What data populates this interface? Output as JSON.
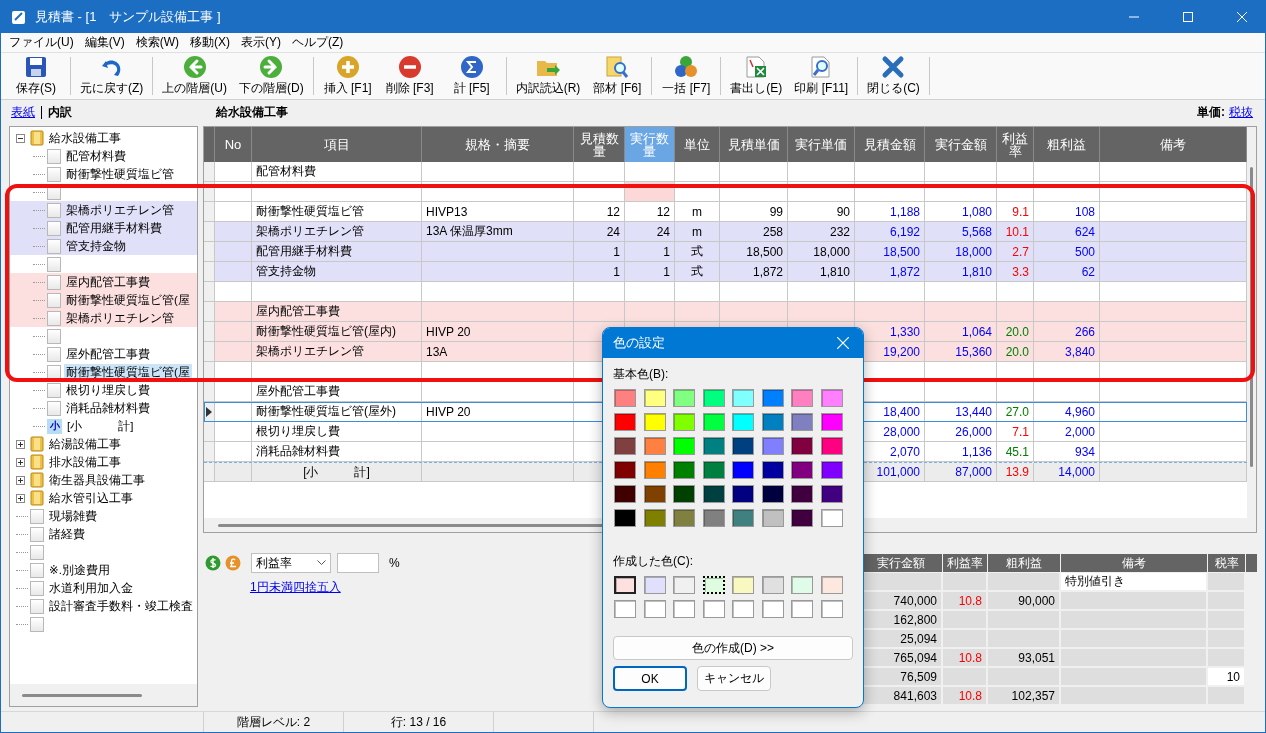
{
  "window": {
    "title": "見積書 - [1　サンプル設備工事 ]"
  },
  "menu": [
    "ファイル(U)",
    "編集(V)",
    "検索(W)",
    "移動(X)",
    "表示(Y)",
    "ヘルプ(Z)"
  ],
  "toolbar": [
    {
      "label": "保存(S)",
      "kind": "save",
      "separator_after": true
    },
    {
      "label": "元に戻す(Z)",
      "kind": "undo",
      "separator_after": true
    },
    {
      "label": "上の階層(U)",
      "kind": "up",
      "separator_after": false
    },
    {
      "label": "下の階層(D)",
      "kind": "down",
      "separator_after": true
    },
    {
      "label": "挿入 [F1]",
      "kind": "insert",
      "separator_after": false
    },
    {
      "label": "削除 [F3]",
      "kind": "delete",
      "separator_after": false
    },
    {
      "label": "計 [F5]",
      "kind": "sum",
      "separator_after": true
    },
    {
      "label": "内訳読込(R)",
      "kind": "import",
      "separator_after": false
    },
    {
      "label": "部材 [F6]",
      "kind": "parts",
      "separator_after": true
    },
    {
      "label": "一括 [F7]",
      "kind": "batch",
      "separator_after": true
    },
    {
      "label": "書出し(E)",
      "kind": "export",
      "separator_after": false
    },
    {
      "label": "印刷 [F11]",
      "kind": "print",
      "separator_after": true
    },
    {
      "label": "閉じる(C)",
      "kind": "close",
      "separator_after": true
    }
  ],
  "breadcrumb": {
    "link": "表紙",
    "current": "内訳"
  },
  "section_title": "給水設備工事",
  "price_mode": {
    "label": "単価:",
    "value": "税抜"
  },
  "tree": [
    {
      "label": "給水設備工事",
      "kind": "folder",
      "expanded": true,
      "selected": false,
      "children": [
        {
          "label": "配管材料費",
          "kind": "doc",
          "selected": false,
          "color": "#ffffff"
        },
        {
          "label": "耐衝撃性硬質塩ビ管",
          "kind": "doc",
          "selected": false,
          "color": "#ffffff"
        },
        {
          "kind": "doc",
          "color": "#ffffff"
        },
        {
          "label": "架橋ポリエチレン管",
          "kind": "doc",
          "selected": false,
          "color": "#e0e0f8"
        },
        {
          "label": "配管用継手材料費",
          "kind": "doc",
          "selected": false,
          "color": "#e0e0f8"
        },
        {
          "label": "管支持金物",
          "kind": "doc",
          "selected": false,
          "color": "#e0e0f8"
        },
        {
          "kind": "doc",
          "color": "#ffffff"
        },
        {
          "label": "屋内配管工事費",
          "kind": "doc",
          "selected": false,
          "color": "#fce0e0"
        },
        {
          "label": "耐衝撃性硬質塩ビ管(屋",
          "kind": "doc",
          "selected": false,
          "color": "#fce0e0"
        },
        {
          "label": "架橋ポリエチレン管",
          "kind": "doc",
          "selected": false,
          "color": "#fce0e0"
        },
        {
          "kind": "doc",
          "color": "#ffffff"
        },
        {
          "label": "屋外配管工事費",
          "kind": "doc",
          "selected": false,
          "color": "#ffffff"
        },
        {
          "label": "耐衝撃性硬質塩ビ管(屋",
          "kind": "doc",
          "selected": true,
          "color": "#ffffff"
        },
        {
          "label": "根切り埋戻し費",
          "kind": "doc",
          "selected": false,
          "color": "#ffffff"
        },
        {
          "label": "消耗品雑材料費",
          "kind": "doc",
          "selected": false,
          "color": "#ffffff"
        },
        {
          "label": "[小　　　計]",
          "kind": "subtotal",
          "badge": "小",
          "selected": false,
          "color": "#ffffff"
        }
      ]
    },
    {
      "label": "給湯設備工事",
      "kind": "folder",
      "expanded": false,
      "selected": false
    },
    {
      "label": "排水設備工事",
      "kind": "folder",
      "expanded": false,
      "selected": false
    },
    {
      "label": "衛生器具設備工事",
      "kind": "folder",
      "expanded": false,
      "selected": false
    },
    {
      "label": "給水管引込工事",
      "kind": "folder",
      "expanded": false,
      "selected": false
    },
    {
      "label": "現場雑費",
      "kind": "doc",
      "selected": false
    },
    {
      "label": "諸経費",
      "kind": "doc",
      "selected": false
    },
    {
      "kind": "doc"
    },
    {
      "label": "※.別途費用",
      "kind": "doc",
      "selected": false
    },
    {
      "label": "水道利用加入金",
      "kind": "doc",
      "selected": false
    },
    {
      "label": "設計審査手数料・竣工検査",
      "kind": "doc",
      "selected": false
    },
    {
      "kind": "doc"
    }
  ],
  "table": {
    "columns": [
      {
        "label": "No",
        "kind": "index",
        "selected": false
      },
      {
        "label": "項目",
        "kind": "text",
        "selected": false
      },
      {
        "label": "規格・摘要",
        "kind": "text",
        "selected": false
      },
      {
        "label": "見積数量",
        "kind": "number",
        "selected": false
      },
      {
        "label": "実行数量",
        "kind": "number",
        "selected": true
      },
      {
        "label": "単位",
        "kind": "unit",
        "selected": false
      },
      {
        "label": "見積単価",
        "kind": "number",
        "selected": false
      },
      {
        "label": "実行単価",
        "kind": "number",
        "selected": false
      },
      {
        "label": "見積金額",
        "kind": "amount",
        "selected": false
      },
      {
        "label": "実行金額",
        "kind": "amount",
        "selected": false
      },
      {
        "label": "利益率",
        "kind": "rate",
        "selected": false
      },
      {
        "label": "粗利益",
        "kind": "amount",
        "selected": false
      },
      {
        "label": "備考",
        "kind": "text",
        "selected": false
      }
    ],
    "rows": [
      {
        "kind": "item",
        "color": "#ffffff",
        "selected": false,
        "flag": false,
        "cells": [
          null,
          "配管材料費",
          null,
          null,
          null,
          null,
          null,
          null,
          null,
          null,
          null,
          null,
          null
        ]
      },
      {
        "kind": "item",
        "color": "#ffffff",
        "selected": false,
        "flag": true,
        "cells": [
          null,
          null,
          null,
          null,
          null,
          null,
          null,
          null,
          null,
          null,
          null,
          null,
          null
        ]
      },
      {
        "kind": "item",
        "color": "#ffffff",
        "selected": false,
        "flag": false,
        "cells": [
          null,
          "耐衝撃性硬質塩ビ管",
          "HIVP13",
          "12",
          "12",
          "m",
          "99",
          "90",
          "1,188",
          "1,080",
          {
            "text": "9.1",
            "color": "#ff0000"
          },
          "108",
          null
        ]
      },
      {
        "kind": "item",
        "color": "#e0e0f8",
        "selected": false,
        "flag": false,
        "cells": [
          null,
          "架橋ポリエチレン管",
          "13A  保温厚3mm",
          "24",
          "24",
          "m",
          "258",
          "232",
          "6,192",
          "5,568",
          {
            "text": "10.1",
            "color": "#ff0000"
          },
          "624",
          null
        ]
      },
      {
        "kind": "item",
        "color": "#e0e0f8",
        "selected": false,
        "flag": false,
        "cells": [
          null,
          "配管用継手材料費",
          null,
          "1",
          "1",
          "式",
          "18,500",
          "18,000",
          "18,500",
          "18,000",
          {
            "text": "2.7",
            "color": "#ff0000"
          },
          "500",
          null
        ]
      },
      {
        "kind": "item",
        "color": "#e0e0f8",
        "selected": false,
        "flag": false,
        "cells": [
          null,
          "管支持金物",
          null,
          "1",
          "1",
          "式",
          "1,872",
          "1,810",
          "1,872",
          "1,810",
          {
            "text": "3.3",
            "color": "#ff0000"
          },
          "62",
          null
        ]
      },
      {
        "kind": "item",
        "color": "#ffffff",
        "selected": false,
        "flag": false,
        "cells": [
          null,
          null,
          null,
          null,
          null,
          null,
          null,
          null,
          null,
          null,
          null,
          null,
          null
        ]
      },
      {
        "kind": "item",
        "color": "#fce0e0",
        "selected": false,
        "flag": false,
        "cells": [
          null,
          "屋内配管工事費",
          null,
          null,
          null,
          null,
          null,
          null,
          null,
          null,
          null,
          null,
          null
        ]
      },
      {
        "kind": "item",
        "color": "#fce0e0",
        "selected": false,
        "flag": false,
        "cells": [
          null,
          "耐衝撃性硬質塩ビ管(屋内)",
          "HIVP 20",
          null,
          null,
          null,
          null,
          null,
          "1,330",
          "1,064",
          {
            "text": "20.0",
            "color": "#008000"
          },
          "266",
          null
        ]
      },
      {
        "kind": "item",
        "color": "#fce0e0",
        "selected": false,
        "flag": false,
        "cells": [
          null,
          "架橋ポリエチレン管",
          "13A",
          null,
          null,
          null,
          null,
          null,
          "19,200",
          "15,360",
          {
            "text": "20.0",
            "color": "#008000"
          },
          "3,840",
          null
        ]
      },
      {
        "kind": "item",
        "color": "#ffffff",
        "selected": false,
        "flag": false,
        "cells": [
          null,
          null,
          null,
          null,
          null,
          null,
          null,
          null,
          null,
          null,
          null,
          null,
          null
        ]
      },
      {
        "kind": "item",
        "color": "#ffffff",
        "selected": false,
        "flag": false,
        "cells": [
          null,
          "屋外配管工事費",
          null,
          null,
          null,
          null,
          null,
          null,
          null,
          null,
          null,
          null,
          null
        ]
      },
      {
        "kind": "item",
        "color": "#ffffff",
        "selected": true,
        "flag": false,
        "cells": [
          null,
          "耐衝撃性硬質塩ビ管(屋外)",
          "HIVP 20",
          null,
          null,
          null,
          null,
          null,
          "18,400",
          "13,440",
          {
            "text": "27.0",
            "color": "#008000"
          },
          "4,960",
          null
        ]
      },
      {
        "kind": "item",
        "color": "#ffffff",
        "selected": false,
        "flag": false,
        "cells": [
          null,
          "根切り埋戻し費",
          null,
          null,
          null,
          null,
          null,
          null,
          "28,000",
          "26,000",
          {
            "text": "7.1",
            "color": "#ff0000"
          },
          "2,000",
          null
        ]
      },
      {
        "kind": "item",
        "color": "#ffffff",
        "selected": false,
        "flag": false,
        "cells": [
          null,
          "消耗品雑材料費",
          null,
          null,
          null,
          null,
          null,
          null,
          "2,070",
          "1,136",
          {
            "text": "45.1",
            "color": "#008000"
          },
          "934",
          null
        ]
      },
      {
        "kind": "subtotal",
        "color": "#ececec",
        "selected": false,
        "flag": false,
        "cells": [
          null,
          "[小　　　計]",
          null,
          null,
          null,
          null,
          null,
          null,
          "101,000",
          "87,000",
          {
            "text": "13.9",
            "color": "#ff0000"
          },
          "14,000",
          null
        ]
      }
    ]
  },
  "calc": {
    "mode": "利益率",
    "unit": "%",
    "rounding_link": "1円未満四捨五入"
  },
  "summary": {
    "columns": [
      "実行金額",
      "利益率",
      "粗利益",
      "備考",
      "税率"
    ],
    "rows": [
      {
        "note_editable": true,
        "tax_editable": false,
        "cells": [
          null,
          null,
          null,
          "特別値引き",
          null
        ]
      },
      {
        "note_editable": false,
        "tax_editable": false,
        "cells": [
          "740,000",
          {
            "text": "10.8",
            "color": "#ff0000"
          },
          "90,000",
          null,
          null
        ]
      },
      {
        "note_editable": false,
        "tax_editable": false,
        "cells": [
          "162,800",
          null,
          null,
          null,
          null
        ]
      },
      {
        "note_editable": false,
        "tax_editable": false,
        "cells": [
          "25,094",
          null,
          null,
          null,
          null
        ]
      },
      {
        "note_editable": false,
        "tax_editable": false,
        "cells": [
          "765,094",
          {
            "text": "10.8",
            "color": "#ff0000"
          },
          "93,051",
          null,
          null
        ]
      },
      {
        "note_editable": false,
        "tax_editable": true,
        "cells": [
          "76,509",
          null,
          null,
          null,
          "10"
        ]
      },
      {
        "note_editable": false,
        "tax_editable": false,
        "cells": [
          "841,603",
          {
            "text": "10.8",
            "color": "#ff0000"
          },
          "102,357",
          null,
          null
        ]
      }
    ]
  },
  "dialog": {
    "title": "色の設定",
    "basic_label": "基本色(B):",
    "custom_label": "作成した色(C):",
    "define_button": "色の作成(D) >>",
    "ok": "OK",
    "cancel": "キャンセル",
    "basic_colors": [
      {
        "color": "#ff8080",
        "selected": false
      },
      {
        "color": "#ffff80",
        "selected": false
      },
      {
        "color": "#80ff80",
        "selected": false
      },
      {
        "color": "#00ff80",
        "selected": false
      },
      {
        "color": "#80ffff",
        "selected": false
      },
      {
        "color": "#0080ff",
        "selected": false
      },
      {
        "color": "#ff80c0",
        "selected": false
      },
      {
        "color": "#ff80ff",
        "selected": false
      },
      {
        "color": "#ff0000",
        "selected": false
      },
      {
        "color": "#ffff00",
        "selected": false
      },
      {
        "color": "#80ff00",
        "selected": false
      },
      {
        "color": "#00ff40",
        "selected": false
      },
      {
        "color": "#00ffff",
        "selected": false
      },
      {
        "color": "#0080c0",
        "selected": false
      },
      {
        "color": "#8080c0",
        "selected": false
      },
      {
        "color": "#ff00ff",
        "selected": false
      },
      {
        "color": "#804040",
        "selected": false
      },
      {
        "color": "#ff8040",
        "selected": false
      },
      {
        "color": "#00ff00",
        "selected": false
      },
      {
        "color": "#008080",
        "selected": false
      },
      {
        "color": "#004080",
        "selected": false
      },
      {
        "color": "#8080ff",
        "selected": false
      },
      {
        "color": "#800040",
        "selected": false
      },
      {
        "color": "#ff0080",
        "selected": false
      },
      {
        "color": "#800000",
        "selected": false
      },
      {
        "color": "#ff8000",
        "selected": false
      },
      {
        "color": "#008000",
        "selected": false
      },
      {
        "color": "#008040",
        "selected": false
      },
      {
        "color": "#0000ff",
        "selected": false
      },
      {
        "color": "#0000a0",
        "selected": false
      },
      {
        "color": "#800080",
        "selected": false
      },
      {
        "color": "#8000ff",
        "selected": false
      },
      {
        "color": "#400000",
        "selected": false
      },
      {
        "color": "#804000",
        "selected": false
      },
      {
        "color": "#004000",
        "selected": false
      },
      {
        "color": "#004040",
        "selected": false
      },
      {
        "color": "#000080",
        "selected": false
      },
      {
        "color": "#000040",
        "selected": false
      },
      {
        "color": "#400040",
        "selected": false
      },
      {
        "color": "#400080",
        "selected": false
      },
      {
        "color": "#000000",
        "selected": false
      },
      {
        "color": "#808000",
        "selected": false
      },
      {
        "color": "#808040",
        "selected": false
      },
      {
        "color": "#808080",
        "selected": false
      },
      {
        "color": "#408080",
        "selected": false
      },
      {
        "color": "#c0c0c0",
        "selected": false
      },
      {
        "color": "#400040",
        "selected": false
      },
      {
        "color": "#ffffff",
        "selected": false
      }
    ],
    "custom_colors": [
      {
        "color": "#fde0e0",
        "selected": true,
        "focused": false
      },
      {
        "color": "#e0e0fc",
        "selected": false,
        "focused": false
      },
      {
        "color": "#f0f0f0",
        "selected": false,
        "focused": false
      },
      {
        "color": "#e0fce0",
        "selected": false,
        "focused": true
      },
      {
        "color": "#f8f8c0",
        "selected": false,
        "focused": false
      },
      {
        "color": "#e0e0e0",
        "selected": false,
        "focused": false
      },
      {
        "color": "#e0fce8",
        "selected": false,
        "focused": false
      },
      {
        "color": "#fde8e0",
        "selected": false,
        "focused": false
      },
      {
        "color": "#ffffff",
        "selected": false,
        "focused": false
      },
      {
        "color": "#ffffff",
        "selected": false,
        "focused": false
      },
      {
        "color": "#ffffff",
        "selected": false,
        "focused": false
      },
      {
        "color": "#ffffff",
        "selected": false,
        "focused": false
      },
      {
        "color": "#ffffff",
        "selected": false,
        "focused": false
      },
      {
        "color": "#ffffff",
        "selected": false,
        "focused": false
      },
      {
        "color": "#ffffff",
        "selected": false,
        "focused": false
      },
      {
        "color": "#ffffff",
        "selected": false,
        "focused": false
      }
    ]
  },
  "status_bar": [
    "階層レベル: 2",
    "行: 13 / 16"
  ]
}
